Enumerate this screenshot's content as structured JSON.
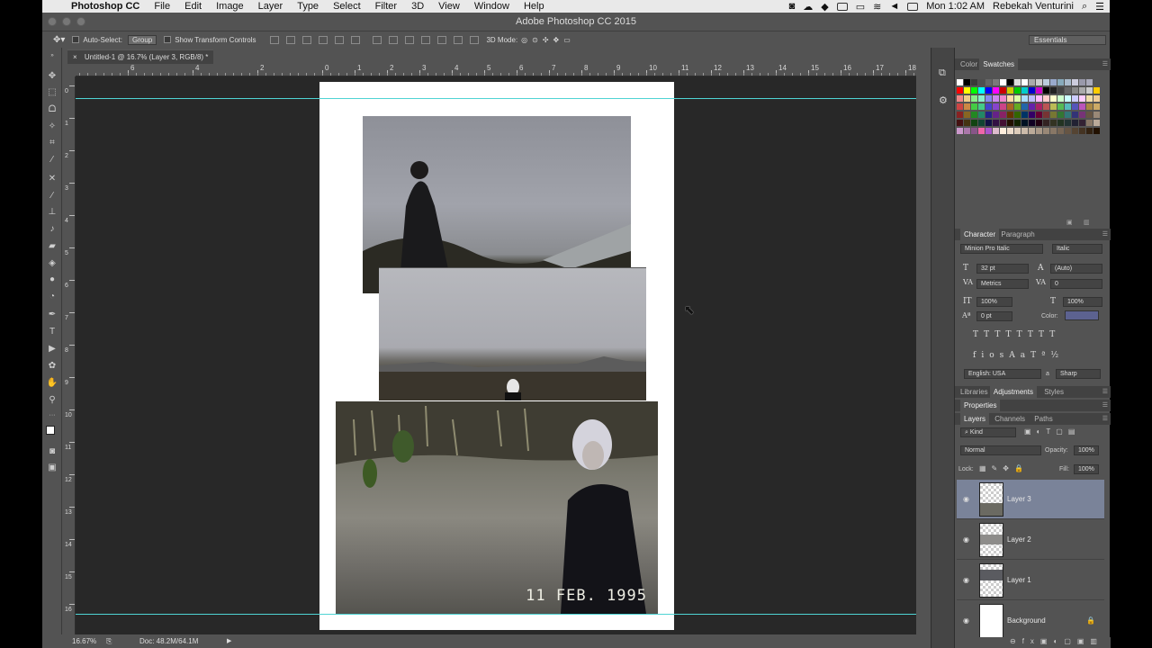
{
  "menubar": {
    "apple": "",
    "app": "Photoshop CC",
    "items": [
      "File",
      "Edit",
      "Image",
      "Layer",
      "Type",
      "Select",
      "Filter",
      "3D",
      "View",
      "Window",
      "Help"
    ],
    "clock": "Mon 1:02 AM",
    "user": "Rebekah Venturini"
  },
  "window": {
    "title": "Adobe Photoshop CC 2015"
  },
  "options": {
    "auto_select_label": "Auto-Select:",
    "auto_select_value": "Group",
    "transform_label": "Show Transform Controls",
    "mode_3d_label": "3D Mode:",
    "workspace": "Essentials"
  },
  "document": {
    "tab_title": "Untitled-1 @ 16.7% (Layer 3, RGB/8) *",
    "stamp_text": "11 FEB. 1995"
  },
  "ruler": {
    "h_labels": [
      "8",
      "6",
      "4",
      "2",
      "0",
      "2",
      "4",
      "6",
      "8",
      "10",
      "12",
      "14",
      "16",
      "18"
    ],
    "h_labels_right": [
      "1",
      "2",
      "3",
      "4",
      "5",
      "6",
      "7",
      "8",
      "9",
      "10",
      "11",
      "12",
      "13",
      "14",
      "15",
      "16",
      "17",
      "18"
    ],
    "v_labels": [
      "0",
      "1",
      "2",
      "3",
      "4",
      "5",
      "6",
      "7",
      "8",
      "9",
      "10",
      "11",
      "12",
      "13",
      "14",
      "15",
      "16"
    ]
  },
  "status": {
    "zoom": "16.67%",
    "doc": "Doc: 48.2M/64.1M"
  },
  "color_panel": {
    "tab_color": "Color",
    "tab_swatches": "Swatches"
  },
  "character": {
    "tab_character": "Character",
    "tab_paragraph": "Paragraph",
    "font": "Minion Pro Italic",
    "style": "Italic",
    "size": "32 pt",
    "leading": "(Auto)",
    "kerning": "Metrics",
    "tracking": "0",
    "vscale": "100%",
    "hscale": "100%",
    "baseline": "0 pt",
    "color_label": "Color:",
    "color_value": "#5c6290",
    "language": "English: USA",
    "aa_label": "a",
    "antialias": "Sharp"
  },
  "panels": {
    "libraries": "Libraries",
    "adjustments": "Adjustments",
    "styles": "Styles",
    "properties": "Properties"
  },
  "layers": {
    "tab_layers": "Layers",
    "tab_channels": "Channels",
    "tab_paths": "Paths",
    "kind": "Kind",
    "blend": "Normal",
    "opacity_label": "Opacity:",
    "opacity": "100%",
    "lock_label": "Lock:",
    "fill_label": "Fill:",
    "fill": "100%",
    "items": [
      {
        "name": "Layer 3",
        "selected": true
      },
      {
        "name": "Layer 2",
        "selected": false
      },
      {
        "name": "Layer 1",
        "selected": false
      },
      {
        "name": "Background",
        "selected": false
      }
    ]
  }
}
